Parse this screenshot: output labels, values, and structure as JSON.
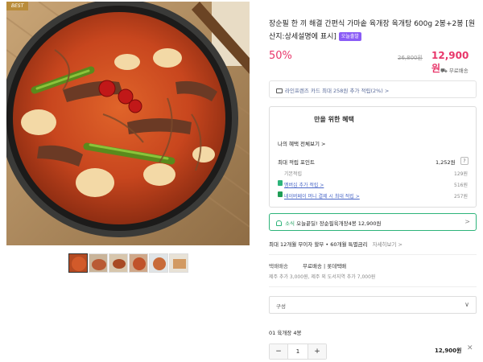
{
  "gallery": {
    "badge": "BEST",
    "thumb_count": 6
  },
  "product": {
    "title": "장순필 한 끼 해결 간편식 가마솥 육개장 육개탕 600g 2봉+2봉 [원산지:상세설명에 표시]",
    "naver_badge": "오늘출발",
    "discount": "50%",
    "original_price": "26,800원",
    "sale_price": "12,900원",
    "shipping_top": "무료배송"
  },
  "card_banner": "라인프렌즈 카드 최대 258원 추가 적립(2%) >",
  "benefits": {
    "title": "만을 위한 혜택",
    "view_all": "나의 혜택 전체보기 >",
    "max_point_label": "최대 적립 포인트",
    "max_point_value": "1,252원",
    "help": "?",
    "rows": [
      {
        "label": "기본적립",
        "value": "129원",
        "link": false
      },
      {
        "label": "멤버십 추가 적립 >",
        "value": "516원",
        "link": true
      },
      {
        "label": "네이버페이 머니 결제 시 최대 적립 >",
        "value": "257원",
        "link": true
      }
    ]
  },
  "notify": {
    "green": "소식",
    "text": "오늘끝딜! 장순필육개장4봉 12,900원",
    "chevron": ">"
  },
  "installment": {
    "text": "최대 12개월 무이자 할부 • 60개월 특별금리",
    "more": "자세히보기 >"
  },
  "shipping": {
    "label": "택배배송",
    "value": "무료배송 | 롯데택배",
    "note": "제주 추가 3,000원, 제주 외 도서지역 추가 7,000원"
  },
  "option": {
    "placeholder": "구성",
    "arrow": "∨"
  },
  "selected_item": {
    "name": "01  육개장 4봉",
    "minus": "−",
    "quantity": "1",
    "plus": "+",
    "price": "12,900원",
    "remove": "✕"
  },
  "colors": {
    "accent_pink": "#e8366a",
    "green": "#2db47a",
    "naver_purple": "#8a5cf6"
  }
}
